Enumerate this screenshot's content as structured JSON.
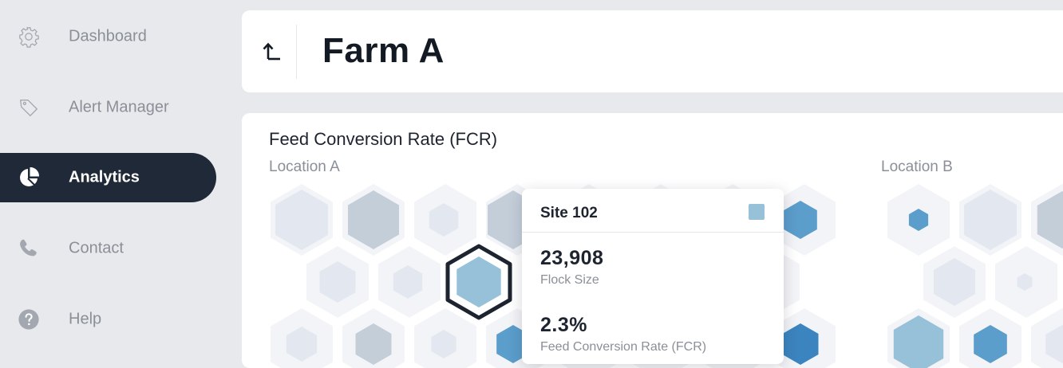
{
  "sidebar": {
    "items": [
      {
        "label": "Dashboard",
        "icon": "gear-icon",
        "active": false
      },
      {
        "label": "Alert Manager",
        "icon": "tag-icon",
        "active": false
      },
      {
        "label": "Analytics",
        "icon": "pie-chart-icon",
        "active": true
      },
      {
        "label": "Contact",
        "icon": "phone-icon",
        "active": false
      },
      {
        "label": "Help",
        "icon": "help-icon",
        "active": false
      }
    ]
  },
  "header": {
    "back_icon": "back-arrow-icon",
    "title": "Farm A"
  },
  "chart": {
    "title": "Feed Conversion Rate (FCR)",
    "location_a": "Location A",
    "location_b": "Location B"
  },
  "tooltip": {
    "site": "Site 102",
    "swatch_color": "#97c1d8",
    "flock_size_value": "23,908",
    "flock_size_label": "Flock Size",
    "fcr_value": "2.3%",
    "fcr_label": "Feed Conversion Rate (FCR)"
  },
  "colors": {
    "sidebar_active_bg": "#1f2937",
    "hex_light": "#e3e7f0",
    "hex_grey_blue": "#c4ced9",
    "hex_mid_blue": "#5b9dcb",
    "hex_selected": "#97c1d8",
    "hex_selected_outline": "#1d2430"
  }
}
